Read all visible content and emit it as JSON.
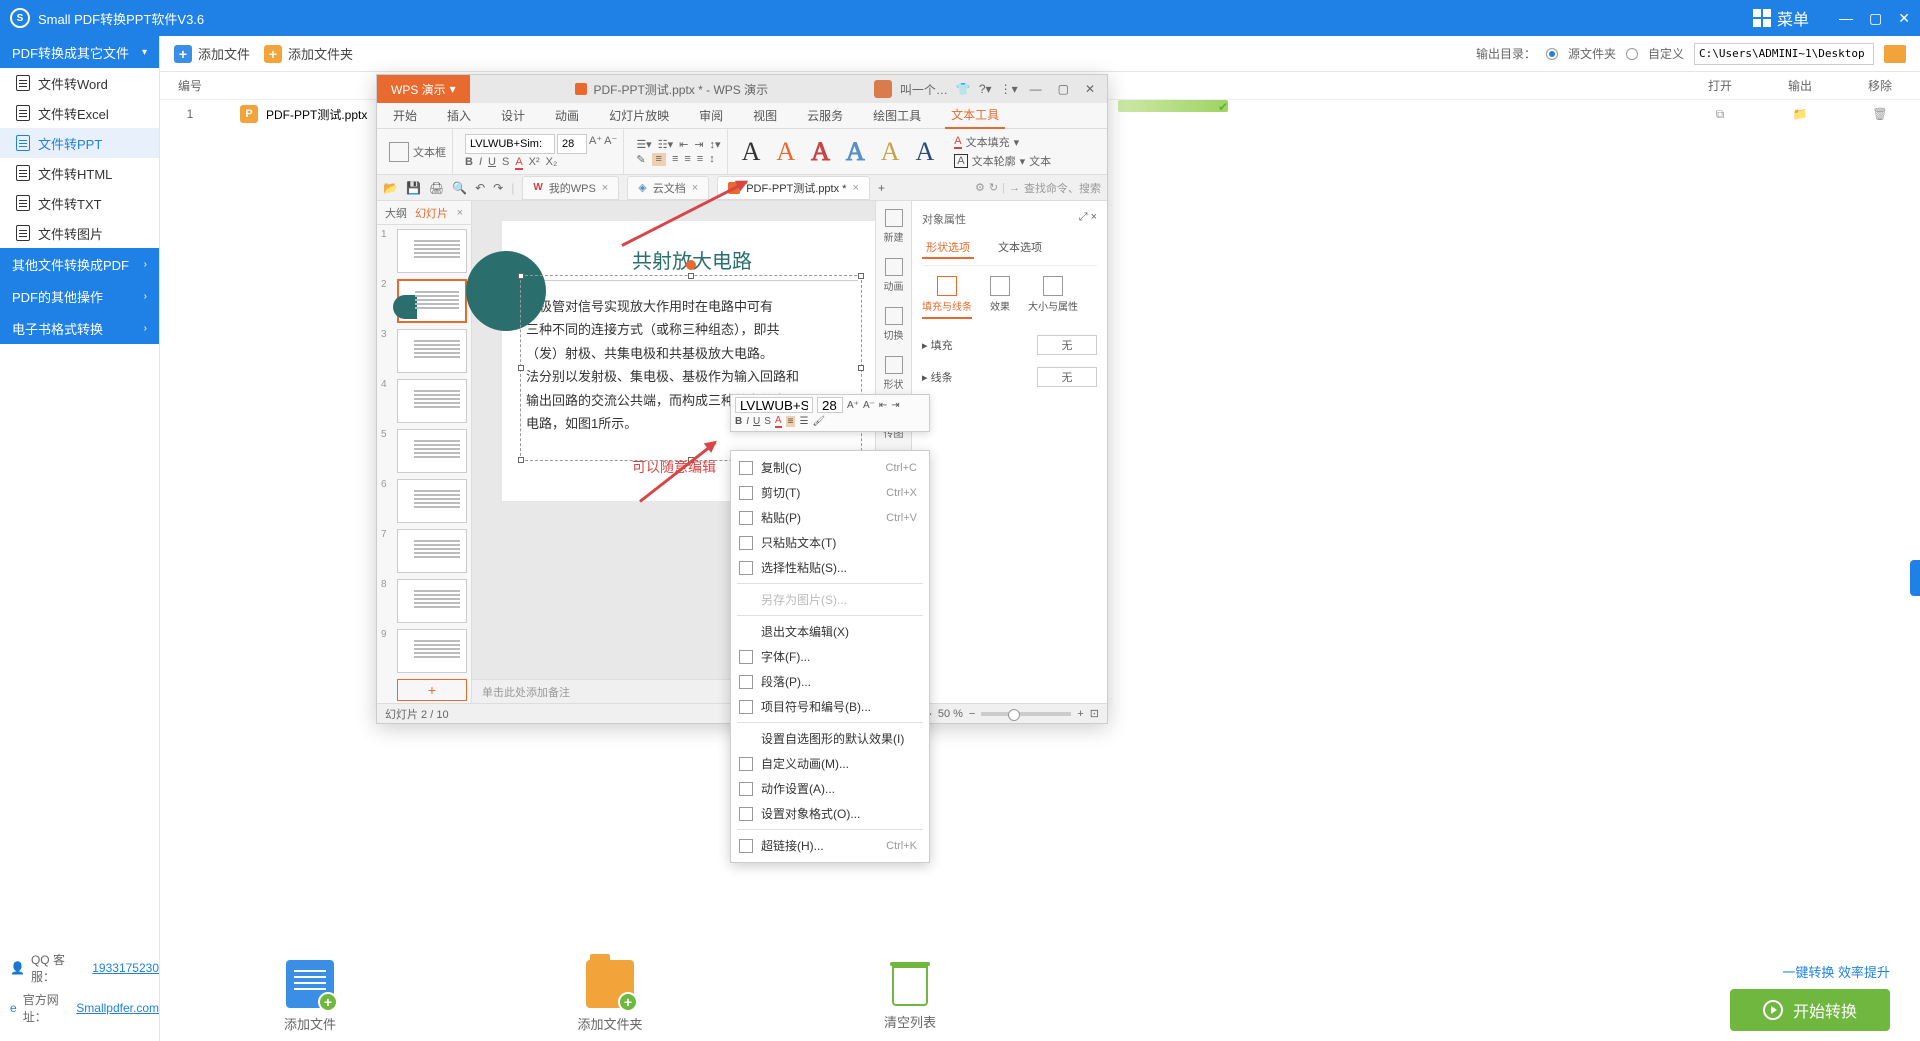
{
  "titlebar": {
    "logo_letter": "S",
    "title": "Small PDF转换PPT软件V3.6",
    "menu_label": "菜单"
  },
  "sidebar": {
    "cat1": "PDF转换成其它文件",
    "items1": [
      "文件转Word",
      "文件转Excel",
      "文件转PPT",
      "文件转HTML",
      "文件转TXT",
      "文件转图片"
    ],
    "cat2": "其他文件转换成PDF",
    "cat3": "PDF的其他操作",
    "cat4": "电子书格式转换",
    "qq_label": "QQ 客服：",
    "qq_number": "1933175230",
    "site_label": "官方网址：",
    "site_url": "Smallpdfer.com"
  },
  "toolbar": {
    "add_file": "添加文件",
    "add_folder": "添加文件夹",
    "output_label": "输出目录：",
    "radio_source": "源文件夹",
    "radio_custom": "自定义",
    "path": "C:\\Users\\ADMINI~1\\Desktop"
  },
  "list": {
    "col_num": "编号",
    "col_open": "打开",
    "col_output": "输出",
    "col_remove": "移除",
    "row_num": "1",
    "row_icon_letter": "P",
    "row_name": "PDF-PPT测试.pptx"
  },
  "bottom": {
    "add_file": "添加文件",
    "add_folder": "添加文件夹",
    "clear_list": "清空列表",
    "slogan": "一键转换  效率提升",
    "start": "开始转换"
  },
  "wps": {
    "product_tab": "WPS 演示",
    "window_title": "PDF-PPT测试.pptx * - WPS 演示",
    "username_short": "叫一个…",
    "menu": [
      "开始",
      "插入",
      "设计",
      "动画",
      "幻灯片放映",
      "审阅",
      "视图",
      "云服务",
      "绘图工具",
      "文本工具"
    ],
    "ribbon": {
      "textbox_label": "文本框",
      "font_name": "LVLWUB+Sim:",
      "font_size": "28",
      "fill_label": "文本填充",
      "outline_label": "文本轮廓",
      "textfx_label": "文本"
    },
    "doc_tabs": {
      "my_wps": "我的WPS",
      "cloud": "云文档",
      "file": "PDF-PPT测试.pptx *"
    },
    "search_placeholder": "查找命令、搜索",
    "thumb_tabs": [
      "大纲",
      "幻灯片"
    ],
    "slide_count": 9,
    "slide": {
      "title": "共射放大电路",
      "lines": [
        "三极管对信号实现放大作用时在电路中可有",
        "三种不同的连接方式（或称三种组态），即共",
        "（发）射极、共集电极和共基极放大电路。",
        "法分别以发射极、集电极、基极作为输入回路和",
        "输出回路的交流公共端，而构成三种基本放大",
        "电路，如图1所示。"
      ],
      "edit_note": "可以随意编辑"
    },
    "notes_placeholder": "单击此处添加备注",
    "status": {
      "slide_pos": "幻灯片 2 / 10",
      "zoom": "50 %"
    },
    "rpane": {
      "header": "对象属性",
      "tab_shape": "形状选项",
      "tab_text": "文本选项",
      "sub1": "填充与线条",
      "sub2": "效果",
      "sub3": "大小与属性",
      "fill_label": "填充",
      "line_label": "线条",
      "none": "无"
    },
    "rtools": [
      "新建",
      "动画",
      "切换",
      "形状",
      "传图"
    ],
    "mini_toolbar": {
      "font": "LVLWUB+SimS",
      "size": "28"
    },
    "ctx": [
      {
        "label": "复制(C)",
        "key": "Ctrl+C"
      },
      {
        "label": "剪切(T)",
        "key": "Ctrl+X"
      },
      {
        "label": "粘贴(P)",
        "key": "Ctrl+V"
      },
      {
        "label": "只粘贴文本(T)",
        "key": ""
      },
      {
        "label": "选择性粘贴(S)...",
        "key": ""
      },
      {
        "label": "另存为图片(S)...",
        "key": "",
        "disabled": true
      },
      {
        "label": "退出文本编辑(X)",
        "key": ""
      },
      {
        "label": "字体(F)...",
        "key": ""
      },
      {
        "label": "段落(P)...",
        "key": ""
      },
      {
        "label": "项目符号和编号(B)...",
        "key": ""
      },
      {
        "label": "设置自选图形的默认效果(I)",
        "key": ""
      },
      {
        "label": "自定义动画(M)...",
        "key": ""
      },
      {
        "label": "动作设置(A)...",
        "key": ""
      },
      {
        "label": "设置对象格式(O)...",
        "key": ""
      },
      {
        "label": "超链接(H)...",
        "key": "Ctrl+K"
      }
    ]
  }
}
